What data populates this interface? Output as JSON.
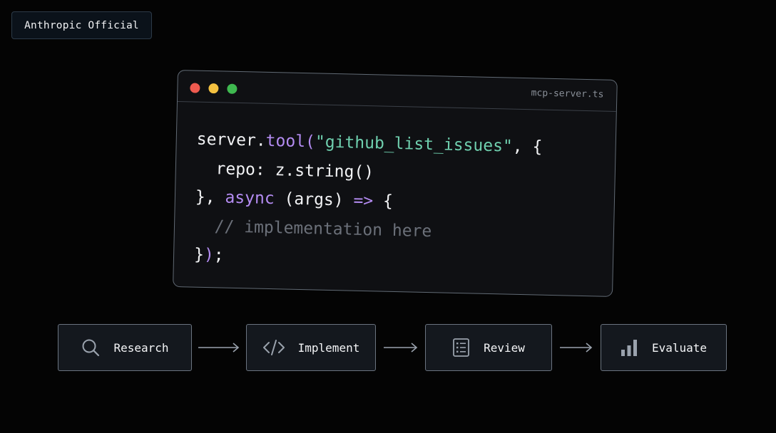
{
  "badge": {
    "label": "Anthropic Official"
  },
  "code_window": {
    "filename": "mcp-server.ts",
    "window_controls": [
      "red-dot",
      "yellow-dot",
      "green-dot"
    ],
    "lines": [
      [
        {
          "t": "server.",
          "k": "pl"
        },
        {
          "t": "tool(",
          "k": "fn"
        },
        {
          "t": "\"github_list_issues\"",
          "k": "str"
        },
        {
          "t": ", {",
          "k": "pl"
        }
      ],
      [
        {
          "t": "  repo: z.string()",
          "k": "pl"
        }
      ],
      [
        {
          "t": "}, ",
          "k": "pl"
        },
        {
          "t": "async",
          "k": "kw"
        },
        {
          "t": " (args) ",
          "k": "pl"
        },
        {
          "t": "=>",
          "k": "kw"
        },
        {
          "t": " {",
          "k": "pl"
        }
      ],
      [
        {
          "t": "  // implementation here",
          "k": "cm"
        }
      ],
      [
        {
          "t": "}",
          "k": "pl"
        },
        {
          "t": ")",
          "k": "fn"
        },
        {
          "t": ";",
          "k": "pl"
        }
      ]
    ]
  },
  "workflow": {
    "steps": [
      {
        "label": "Research",
        "icon": "search-icon"
      },
      {
        "label": "Implement",
        "icon": "code-icon"
      },
      {
        "label": "Review",
        "icon": "document-icon"
      },
      {
        "label": "Evaluate",
        "icon": "bar-chart-icon"
      }
    ]
  },
  "colors": {
    "background": "#040404",
    "function": "#b48cf2",
    "string": "#6fcfae",
    "comment": "#6b7079",
    "dot_red": "#ee5a4f",
    "dot_yellow": "#f4c140",
    "dot_green": "#3fb950"
  }
}
